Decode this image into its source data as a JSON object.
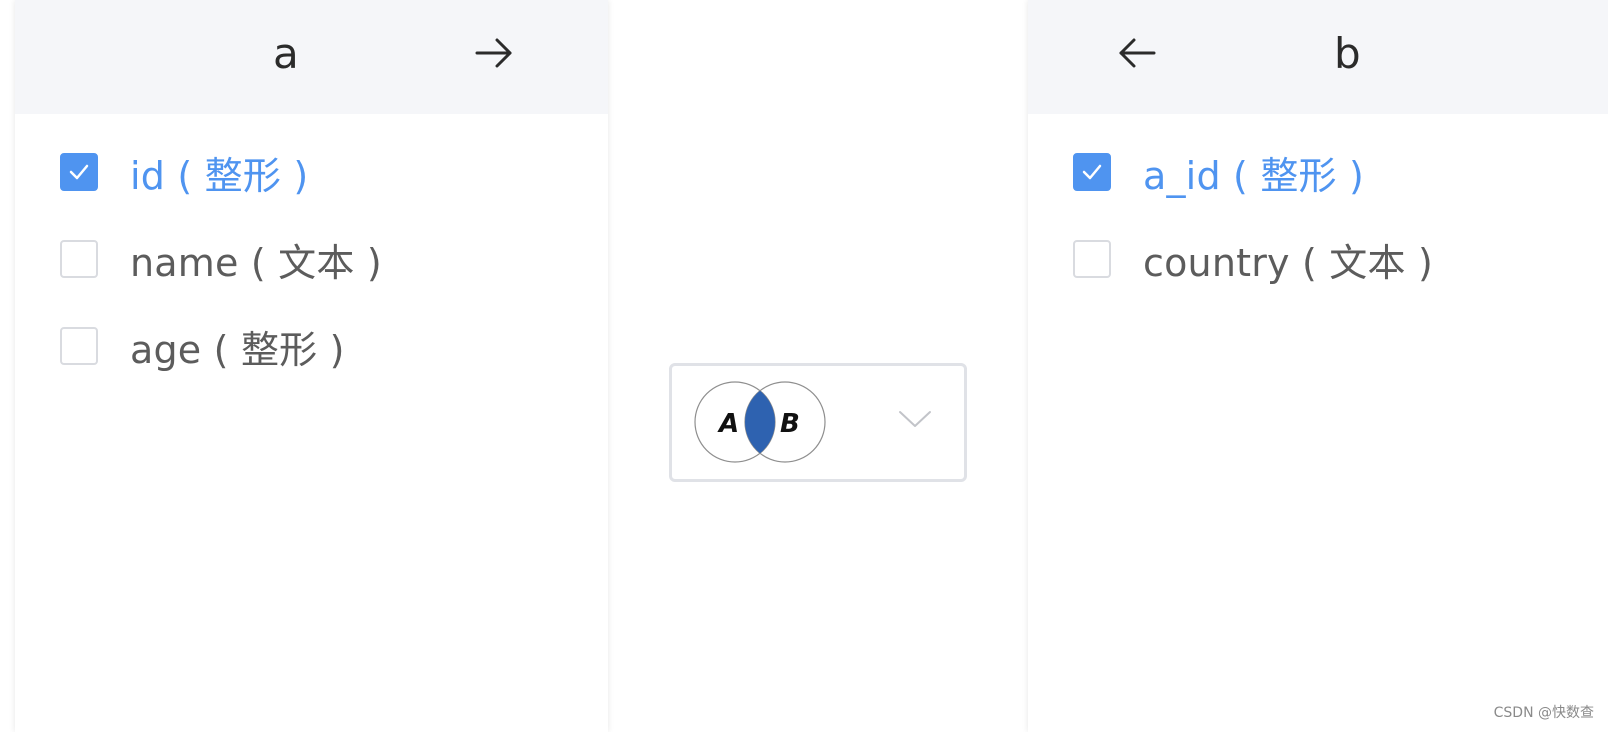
{
  "left_table": {
    "title": "a",
    "arrow": "arrow-right-icon",
    "fields": [
      {
        "label": "id ( 整形 )",
        "checked": true
      },
      {
        "label": "name ( 文本 )",
        "checked": false
      },
      {
        "label": "age ( 整形 )",
        "checked": false
      }
    ]
  },
  "right_table": {
    "title": "b",
    "arrow": "arrow-left-icon",
    "fields": [
      {
        "label": "a_id ( 整形 )",
        "checked": true
      },
      {
        "label": "country ( 文本 )",
        "checked": false
      }
    ]
  },
  "join": {
    "icon": "venn-inner-join-icon",
    "label_a": "A",
    "label_b": "B",
    "selected": "inner join",
    "accent_color": "#2e62b0"
  },
  "colors": {
    "checked": "#4f94f0",
    "header_bg": "#f5f6f9"
  },
  "watermark": "CSDN @快数查"
}
